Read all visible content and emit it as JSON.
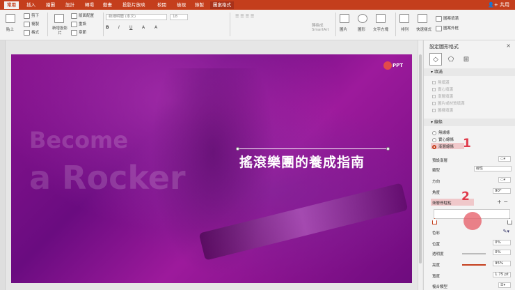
{
  "tabs": [
    "常用",
    "插入",
    "繪圖",
    "設計",
    "轉場",
    "動畫",
    "投影片放映",
    "校閱",
    "檢視",
    "錄製",
    "圖案格式"
  ],
  "share": "共用",
  "ribbon": {
    "paste": "貼上",
    "cut": "剪下",
    "copy": "複製",
    "format": "格式",
    "new_slide": "新增投影片",
    "layout": "版面配置",
    "reset": "重設",
    "section": "章節",
    "font_name": "新細明體 (本文)",
    "font_size": "18",
    "smartart": "轉換成 SmartArt",
    "picture": "圖片",
    "shapes": "圖形",
    "textbox": "文字方塊",
    "arrange": "排列",
    "quick_styles": "快速樣式",
    "shape_fill": "圖案填滿",
    "shape_outline": "圖案外框"
  },
  "slide": {
    "title": "搖滾樂團的養成指南",
    "bg_line1": "Become",
    "bg_line2": "a Rocker",
    "logo": "PPT"
  },
  "panel": {
    "title": "設定圖形格式",
    "fill_section": "填滿",
    "fill_options": [
      "無填滿",
      "實心填滿",
      "漸層填滿",
      "圖片或材質填滿",
      "圖樣填滿"
    ],
    "line_section": "線條",
    "line_options": [
      "無線條",
      "實心線條",
      "漸層線條"
    ],
    "preset_gradient": "預設漸層",
    "type_label": "類型",
    "type_value": "線性",
    "direction_label": "方向",
    "angle_label": "角度",
    "angle_value": "90°",
    "gradient_stops_label": "漸層停駐點",
    "color_label": "色彩",
    "position_label": "位置",
    "position_value": "0%",
    "transparency_label": "透明度",
    "transparency_value": "0%",
    "brightness_label": "亮度",
    "brightness_value": "95%",
    "width_label": "寬度",
    "width_value": "1.75 pt",
    "compound_label": "複合類型"
  },
  "annotations": {
    "step1": "1",
    "step2": "2"
  },
  "colors": {
    "accent": "#c43e1c",
    "annotation": "#e03a4a",
    "slide_bg": "#7d108a"
  }
}
